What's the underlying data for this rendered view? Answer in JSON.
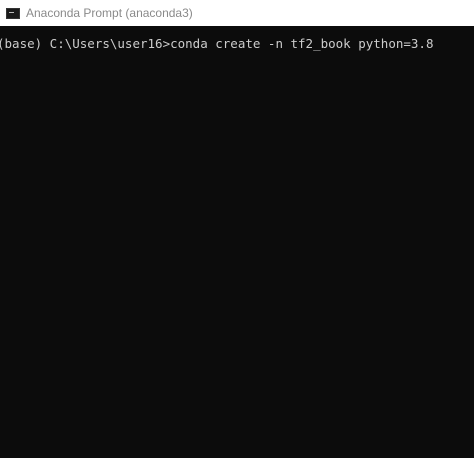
{
  "window": {
    "title": "Anaconda Prompt (anaconda3)",
    "icon": "terminal-icon"
  },
  "console": {
    "lines": [
      "(base) C:\\Users\\user16>conda create -n tf2_book python=3.8"
    ]
  },
  "colors": {
    "background": "#0c0c0c",
    "text": "#cccccc",
    "titlebar": "#ffffff",
    "title_text": "#8a8a8a"
  }
}
